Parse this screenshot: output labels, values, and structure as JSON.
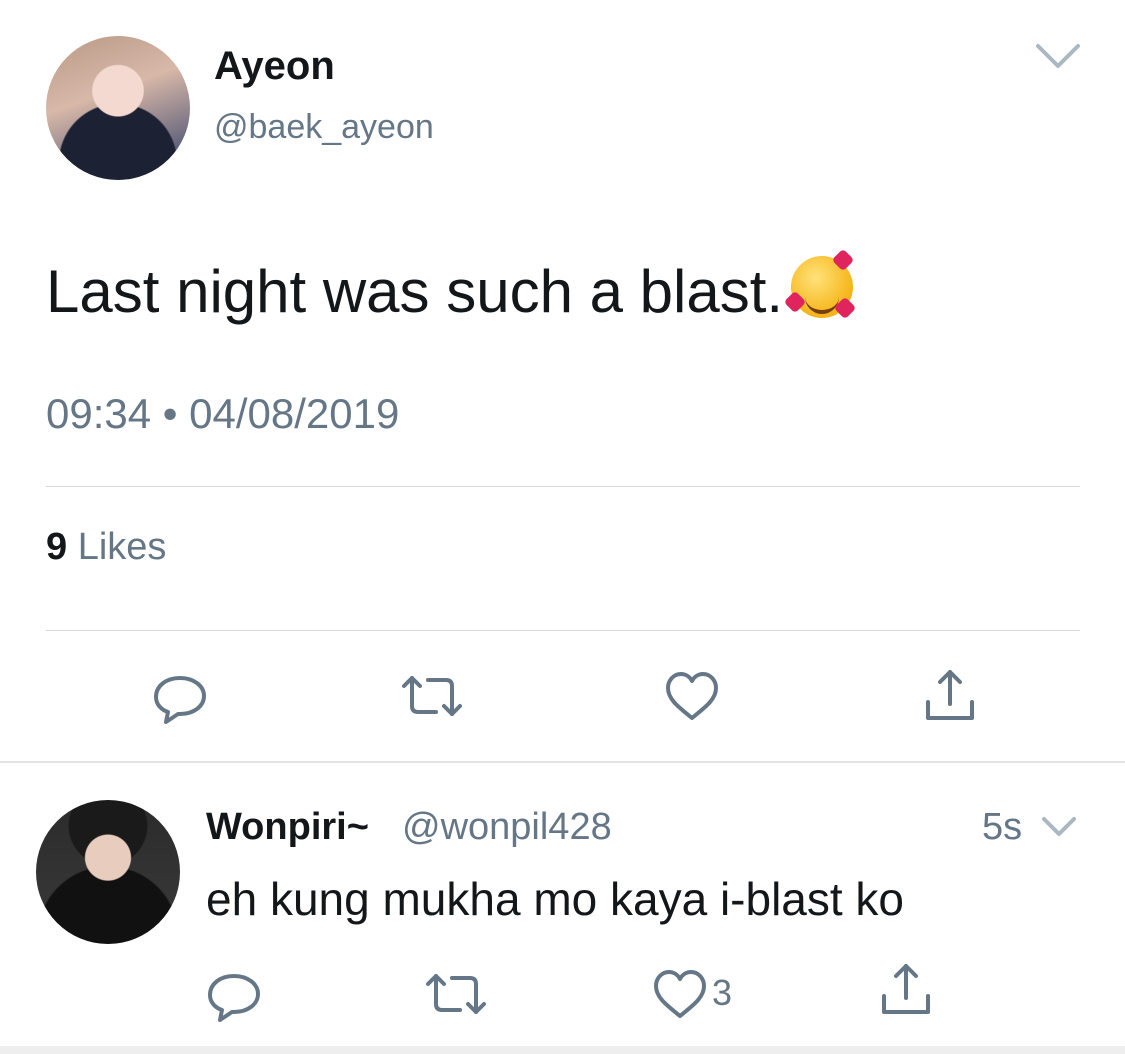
{
  "tweet": {
    "author_name": "Ayeon",
    "author_handle": "@baek_ayeon",
    "text": "Last night was such a blast.",
    "emoji": "smiling-face-with-hearts",
    "timestamp": "09:34 • 04/08/2019",
    "likes_count": "9",
    "likes_label": "Likes",
    "actions": [
      "reply-icon",
      "retweet-icon",
      "like-icon",
      "share-icon"
    ]
  },
  "reply": {
    "author_name": "Wonpiri~",
    "author_handle": "@wonpil428",
    "time": "5s",
    "text": "eh kung mukha mo kaya i-blast ko",
    "like_count": "3",
    "actions": [
      "reply-icon",
      "retweet-icon",
      "like-icon",
      "share-icon"
    ]
  },
  "colors": {
    "primary_text": "#14171a",
    "secondary_text": "#657786",
    "divider": "#d8d8d8"
  }
}
